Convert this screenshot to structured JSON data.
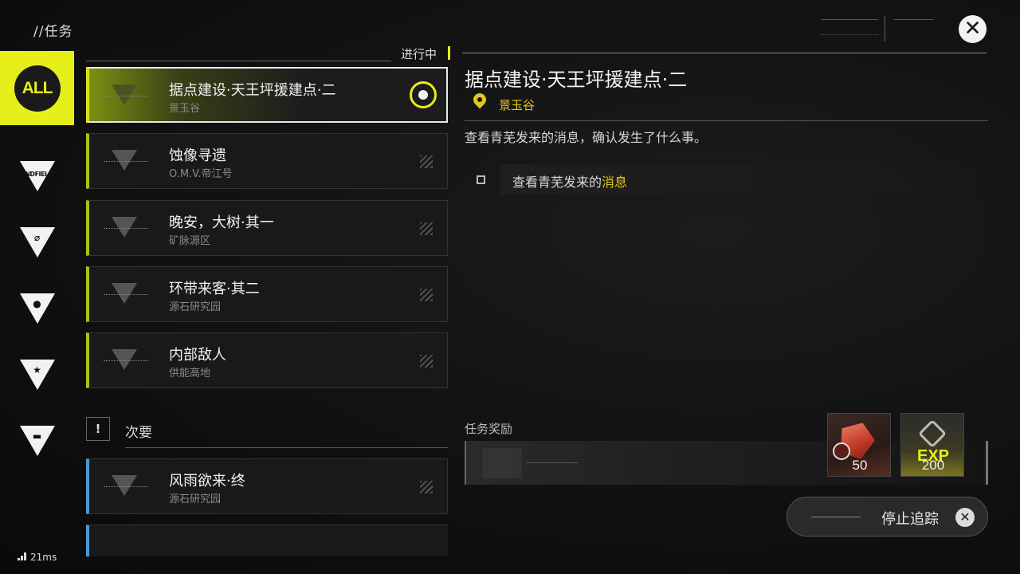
{
  "page": {
    "title": "//任务"
  },
  "sidebar": {
    "items": [
      {
        "label": "ALL",
        "icon": "all-icon",
        "active": true
      },
      {
        "label": "ENDFIELD",
        "icon": "endfield-icon",
        "active": false
      },
      {
        "label": "",
        "icon": "hook-icon",
        "active": false
      },
      {
        "label": "",
        "icon": "person-icon",
        "active": false
      },
      {
        "label": "",
        "icon": "star-icon",
        "active": false
      },
      {
        "label": "",
        "icon": "bracket-icon",
        "active": false
      }
    ]
  },
  "quests": {
    "section_label": "进行中",
    "main": [
      {
        "title": "据点建设·天王坪援建点·二",
        "location": "景玉谷",
        "selected": true
      },
      {
        "title": "蚀像寻遗",
        "location": "O.M.V.帝江号",
        "selected": false
      },
      {
        "title": "晚安，大树·其一",
        "location": "矿脉源区",
        "selected": false
      },
      {
        "title": "环带来客·其二",
        "location": "源石研究园",
        "selected": false
      },
      {
        "title": "内部敌人",
        "location": "供能高地",
        "selected": false
      }
    ],
    "secondary_icon": "!",
    "secondary_label": "次要",
    "secondary": [
      {
        "title": "风雨欲来·终",
        "location": "源石研究园"
      }
    ]
  },
  "detail": {
    "title": "据点建设·天王坪援建点·二",
    "location": "景玉谷",
    "description": "查看青芜发来的消息，确认发生了什么事。",
    "objective_prefix": "查看青芜发来的",
    "objective_highlight": "消息"
  },
  "rewards": {
    "label": "任务奖励",
    "items": [
      {
        "icon": "red-crystal-icon",
        "count": "50"
      },
      {
        "icon": "exp-icon",
        "name": "EXP",
        "count": "200"
      }
    ]
  },
  "actions": {
    "stop_tracking": "停止追踪",
    "close_symbol": "✕"
  },
  "status": {
    "ping": "21ms"
  },
  "colors": {
    "accent": "#e6ef19",
    "location": "#e6c619",
    "secondary": "#4a9ad8"
  }
}
